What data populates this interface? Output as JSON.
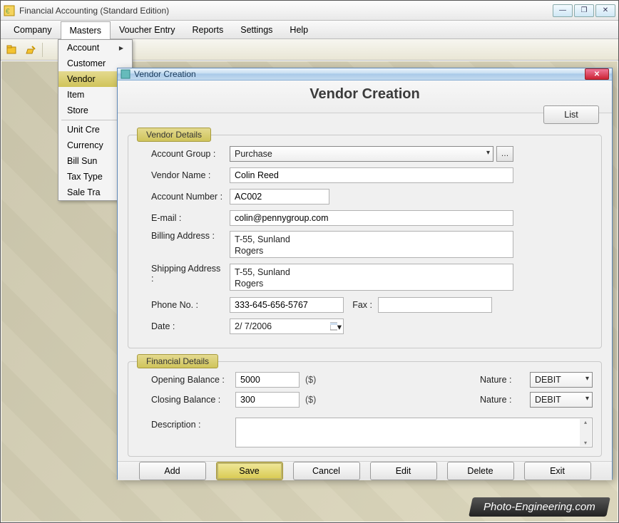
{
  "appTitle": "Financial Accounting (Standard Edition)",
  "menubar": [
    "Company",
    "Masters",
    "Voucher Entry",
    "Reports",
    "Settings",
    "Help"
  ],
  "activeMenuIndex": 1,
  "dropdown": {
    "items": [
      "Account",
      "Customer",
      "Vendor",
      "Item",
      "Store",
      "Unit Cre",
      "Currency",
      "Bill Sun",
      "Tax Type",
      "Sale Tra"
    ],
    "hasSubIndex": 0,
    "highlightIndex": 2,
    "sepAfterIndex": 4
  },
  "dialog": {
    "title": "Vendor Creation",
    "heading": "Vendor Creation",
    "listBtn": "List",
    "vendorDetailsLabel": "Vendor Details",
    "financialDetailsLabel": "Financial Details",
    "labels": {
      "accountGroup": "Account Group :",
      "vendorName": "Vendor Name :",
      "accountNumber": "Account Number :",
      "email": "E-mail :",
      "billing": "Billing Address :",
      "shipping": "Shipping Address :",
      "phone": "Phone No. :",
      "fax": "Fax :",
      "date": "Date :",
      "openingBalance": "Opening Balance :",
      "closingBalance": "Closing Balance :",
      "currency": "($)",
      "nature": "Nature :",
      "description": "Description :"
    },
    "values": {
      "accountGroup": "Purchase",
      "vendorName": "Colin Reed",
      "accountNumber": "AC002",
      "email": "colin@pennygroup.com",
      "billing": " T-55, Sunland\nRogers",
      "shipping": " T-55, Sunland\nRogers",
      "phone": "333-645-656-5767",
      "fax": "",
      "date": " 2/  7/2006",
      "openingBalance": "5000",
      "closingBalance": "300",
      "nature1": "DEBIT",
      "nature2": "DEBIT",
      "description": ""
    },
    "buttons": [
      "Add",
      "Save",
      "Cancel",
      "Edit",
      "Delete",
      "Exit"
    ],
    "primaryIndex": 1
  },
  "watermark": "Photo-Engineering.com"
}
